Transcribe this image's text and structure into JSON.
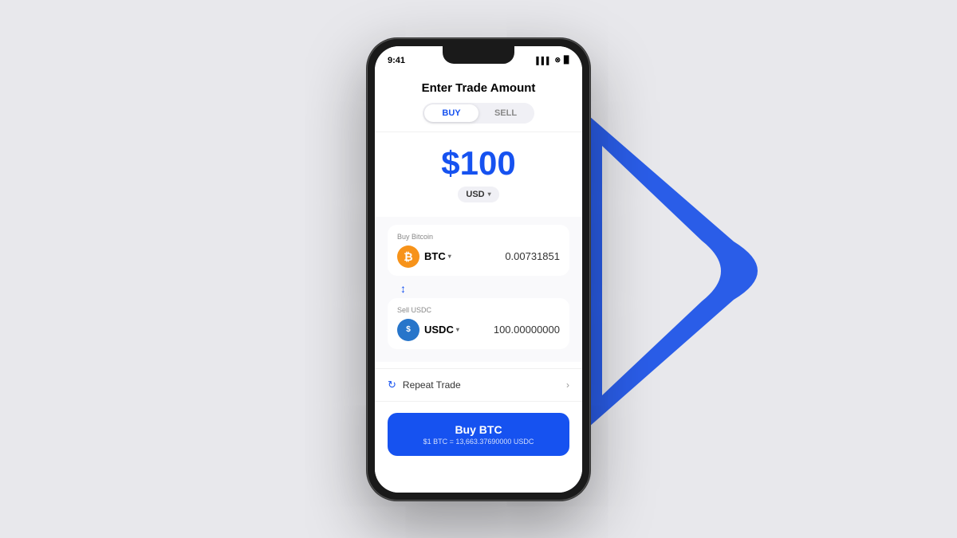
{
  "background": {
    "chevron_color": "#2055e8"
  },
  "status_bar": {
    "time": "9:41",
    "signal": "▌▌▌",
    "wifi": "WiFi",
    "battery": "🔋"
  },
  "header": {
    "title": "Enter Trade Amount",
    "buy_label": "BUY",
    "sell_label": "SELL"
  },
  "amount": {
    "value": "$100",
    "currency": "USD",
    "currency_chevron": "▾"
  },
  "buy_pair": {
    "label": "Buy Bitcoin",
    "coin_symbol": "BTC",
    "coin_chevron": "▾",
    "amount": "0.00731851"
  },
  "sell_pair": {
    "label": "Sell USDC",
    "coin_symbol": "USDC",
    "coin_chevron": "▾",
    "amount": "100.00000000"
  },
  "repeat_trade": {
    "label": "Repeat Trade",
    "chevron": "›"
  },
  "buy_button": {
    "label": "Buy BTC",
    "rate": "$1 BTC = 13,663.37690000 USDC"
  }
}
